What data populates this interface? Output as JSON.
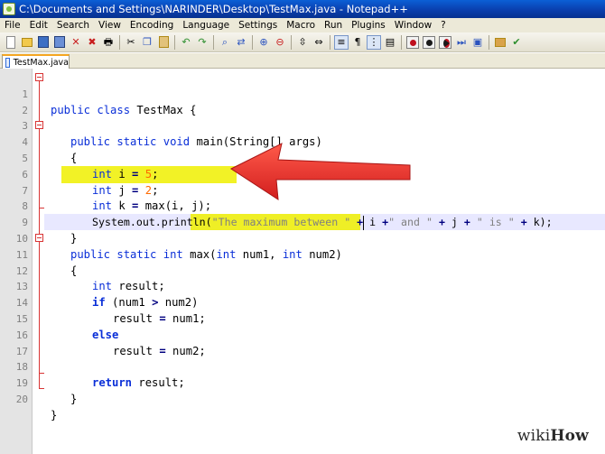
{
  "window": {
    "title": "C:\\Documents and Settings\\NARINDER\\Desktop\\TestMax.java - Notepad++"
  },
  "menu": [
    "File",
    "Edit",
    "Search",
    "View",
    "Encoding",
    "Language",
    "Settings",
    "Macro",
    "Run",
    "Plugins",
    "Window",
    "?"
  ],
  "toolbar": {
    "icons": [
      "new-file-icon",
      "open-file-icon",
      "save-icon",
      "save-all-icon",
      "close-icon",
      "close-all-icon",
      "print-icon",
      "cut-icon",
      "copy-icon",
      "paste-icon",
      "undo-icon",
      "redo-icon",
      "find-icon",
      "replace-icon",
      "zoom-in-icon",
      "zoom-out-icon",
      "sync-vertical-icon",
      "sync-horizontal-icon",
      "word-wrap-icon",
      "show-all-chars-icon",
      "indent-guide-icon",
      "user-language-icon",
      "record-macro-icon",
      "stop-record-icon",
      "play-macro-icon",
      "play-multiple-icon",
      "save-macro-icon",
      "launch-browser-icon",
      "spellcheck-icon"
    ]
  },
  "tab": {
    "label": "TestMax.java"
  },
  "editor": {
    "line_numbers": [
      "1",
      "2",
      "3",
      "4",
      "5",
      "6",
      "7",
      "8",
      "9",
      "10",
      "11",
      "12",
      "13",
      "14",
      "15",
      "16",
      "17",
      "18",
      "19",
      "20"
    ],
    "lines": {
      "l1": {
        "kw1": "public",
        "kw2": "class",
        "rest": " TestMax {"
      },
      "l3": {
        "kw1": "public",
        "kw2": "static",
        "kw3": "void",
        "rest": " main(String[] args)"
      },
      "l4": {
        "text": "{"
      },
      "l5": {
        "kw": "int",
        "mid": " i ",
        "op": "=",
        "sp": " ",
        "num": "5",
        "end": ";"
      },
      "l6": {
        "kw": "int",
        "mid": " j ",
        "op": "=",
        "sp": " ",
        "num": "2",
        "end": ";"
      },
      "l7": {
        "kw": "int",
        "mid": " k ",
        "op": "=",
        "rest": " max(i, j);"
      },
      "l8": {
        "pre": "System.out.println(",
        "s1": "\"The maximum between \"",
        "op1": " + ",
        "v1": "i",
        "op2": " +",
        "s2": "\" and \"",
        "op3": " + ",
        "v2": "j",
        "op4": " + ",
        "s3": "\" is \"",
        "op5": " + ",
        "v3": "k);"
      },
      "l9": {
        "text": "}"
      },
      "l10": {
        "kw1": "public",
        "kw2": "static",
        "kw3": "int",
        "name": " max(",
        "kw4": "int",
        "p1": " num1, ",
        "kw5": "int",
        "p2": " num2)"
      },
      "l11": {
        "text": "{"
      },
      "l12": {
        "kw": "int",
        "rest": " result;"
      },
      "l13": {
        "kw": "if",
        "rest": " (num1 ",
        "op": ">",
        "rest2": " num2)"
      },
      "l14": {
        "rest": "result ",
        "op": "=",
        "rest2": " num1;"
      },
      "l15": {
        "kw": "else"
      },
      "l16": {
        "rest": "result ",
        "op": "=",
        "rest2": " num2;"
      },
      "l18": {
        "kw": "return",
        "rest": " result;"
      },
      "l19": {
        "text": "}"
      },
      "l20": {
        "text": "}"
      }
    }
  },
  "watermark": {
    "brand_a": "wiki",
    "brand_b": "How"
  },
  "colors": {
    "keyword": "#0a2fd8",
    "number": "#ff6a00",
    "string": "#808080",
    "highlight": "#f0f000",
    "current_line": "#e8e8ff",
    "arrow": "#e83030",
    "fold_marker": "#d83434"
  }
}
